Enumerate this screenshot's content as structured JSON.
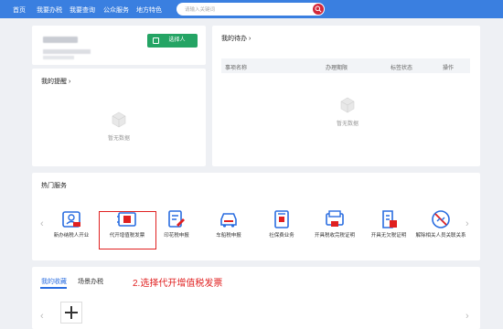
{
  "nav": {
    "items": [
      "首页",
      "我要办税",
      "我要查询",
      "公众服务",
      "地方特色"
    ]
  },
  "search": {
    "placeholder": "请输入关键词"
  },
  "user_card": {
    "switch_button": "选择人"
  },
  "reminders": {
    "title": "我的提醒 ›",
    "empty_text": "暂无数据"
  },
  "todos": {
    "title": "我的待办 ›",
    "columns": [
      "事项名称",
      "办理期限",
      "标签状态",
      "操作"
    ],
    "empty_text": "暂无数据"
  },
  "hot_services": {
    "title": "热门服务",
    "items": [
      {
        "label": "新办纳税人开业",
        "icon": "id-card-icon"
      },
      {
        "label": "代开增值税发票",
        "icon": "invoice-icon"
      },
      {
        "label": "印花税申报",
        "icon": "stamp-icon"
      },
      {
        "label": "车船税申报",
        "icon": "car-icon"
      },
      {
        "label": "社保费业务",
        "icon": "social-security-icon"
      },
      {
        "label": "开具税收完税证明",
        "icon": "tax-certificate-icon"
      },
      {
        "label": "开具无欠税证明",
        "icon": "no-arrears-icon"
      },
      {
        "label": "解除相关人员关联关系",
        "icon": "unlink-icon"
      }
    ]
  },
  "tabs": {
    "favorites": "我的收藏",
    "scenario": "场景办税"
  },
  "annotation": "2.选择代开增值税发票",
  "colors": {
    "header": "#3a7fe0",
    "accent": "#2a6de0",
    "green": "#24a464",
    "red": "#e02020"
  }
}
